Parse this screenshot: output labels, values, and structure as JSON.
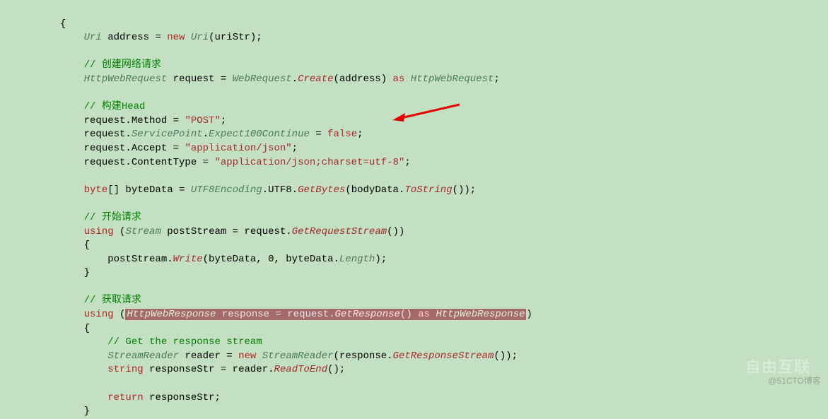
{
  "code": {
    "l1_brace": "{",
    "l2_p1": "Uri",
    "l2_p2": " address = ",
    "l2_p3": "new",
    "l2_p4": " ",
    "l2_p5": "Uri",
    "l2_p6": "(uriStr);",
    "l3_comment": "// 创建网络请求",
    "l4_p1": "HttpWebRequest",
    "l4_p2": " request = ",
    "l4_p3": "WebRequest",
    "l4_p4": ".",
    "l4_p5": "Create",
    "l4_p6": "(address) ",
    "l4_p7": "as",
    "l4_p8": " ",
    "l4_p9": "HttpWebRequest",
    "l4_p10": ";",
    "l5_comment": "// 构建Head",
    "l6_p1": "request.Method = ",
    "l6_p2": "\"POST\"",
    "l6_p3": ";",
    "l7_p1": "request.",
    "l7_p2": "ServicePoint",
    "l7_p3": ".",
    "l7_p4": "Expect100Continue",
    "l7_p5": " = ",
    "l7_p6": "false",
    "l7_p7": ";",
    "l8_p1": "request.Accept = ",
    "l8_p2": "\"application/json\"",
    "l8_p3": ";",
    "l9_p1": "request.ContentType = ",
    "l9_p2": "\"application/json;charset=utf-8\"",
    "l9_p3": ";",
    "l10_p1": "byte",
    "l10_p2": "[] byteData = ",
    "l10_p3": "UTF8Encoding",
    "l10_p4": ".UTF8.",
    "l10_p5": "GetBytes",
    "l10_p6": "(bodyData.",
    "l10_p7": "ToString",
    "l10_p8": "());",
    "l11_comment": "// 开始请求",
    "l12_p1": "using",
    "l12_p2": " (",
    "l12_p3": "Stream",
    "l12_p4": " postStream = request.",
    "l12_p5": "GetRequestStream",
    "l12_p6": "())",
    "l13_brace": "{",
    "l14_p1": "postStream.",
    "l14_p2": "Write",
    "l14_p3": "(byteData, 0, byteData.",
    "l14_p4": "Length",
    "l14_p5": ");",
    "l15_brace": "}",
    "l16_comment": "// 获取请求",
    "l17_p1": "using",
    "l17_p2": " (",
    "l17_b1": "HttpWebResponse",
    "l17_b2": " response = request.",
    "l17_b3": "GetResponse",
    "l17_b4": "() ",
    "l17_b5": "as",
    "l17_b6": " ",
    "l17_b7": "HttpWebResponse",
    "l17_p3": ")",
    "l18_brace": "{",
    "l19_comment": "// Get the response stream",
    "l20_p1": "StreamReader",
    "l20_p2": " reader = ",
    "l20_p3": "new",
    "l20_p4": " ",
    "l20_p5": "StreamReader",
    "l20_p6": "(response.",
    "l20_p7": "GetResponseStream",
    "l20_p8": "());",
    "l21_p1": "string",
    "l21_p2": " responseStr = reader.",
    "l21_p3": "ReadToEnd",
    "l21_p4": "();",
    "l22_p1": "return",
    "l22_p2": " responseStr;",
    "l23_brace": "}"
  },
  "watermark": "@51CTO博客",
  "watermark_logo": "自由互联"
}
